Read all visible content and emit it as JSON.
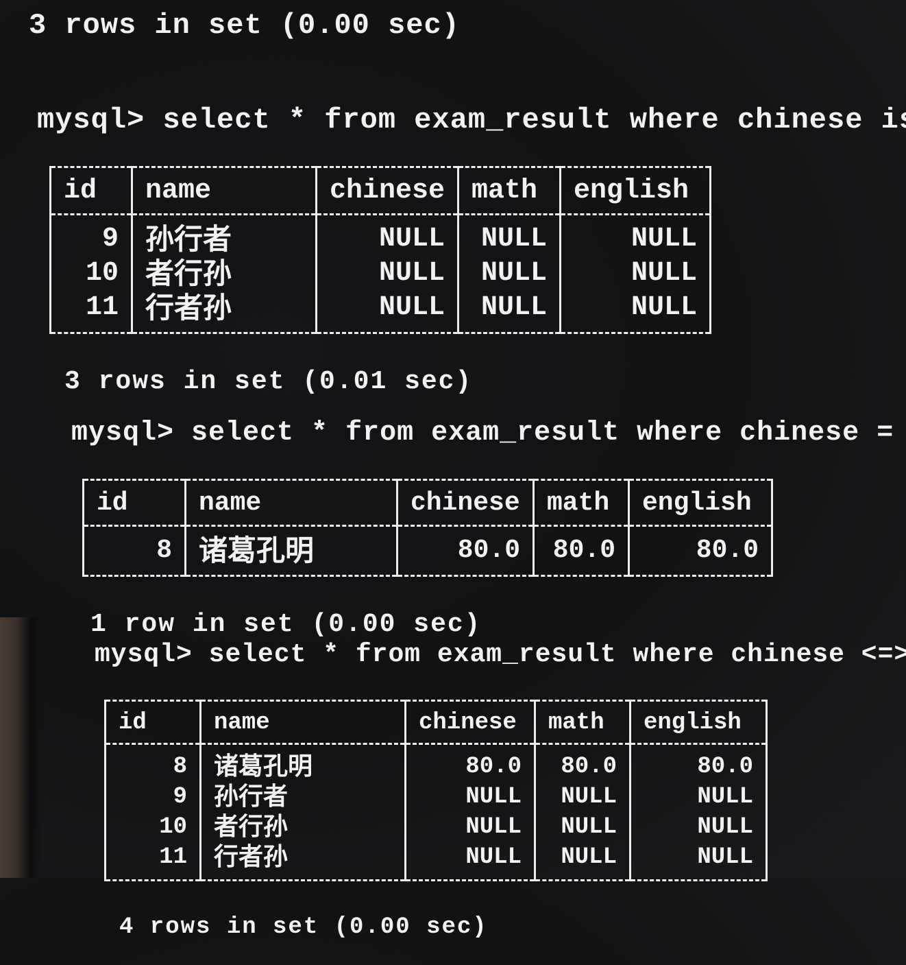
{
  "top_summary": "3 rows in set (0.00 sec)",
  "queries": [
    {
      "prompt": "mysql> ",
      "command": "select * from exam_result where chinese is null;",
      "columns": [
        "id",
        "name",
        "chinese",
        "math",
        "english"
      ],
      "rows": [
        {
          "id": "9",
          "name": "孙行者",
          "chinese": "NULL",
          "math": "NULL",
          "english": "NULL"
        },
        {
          "id": "10",
          "name": "者行孙",
          "chinese": "NULL",
          "math": "NULL",
          "english": "NULL"
        },
        {
          "id": "11",
          "name": "行者孙",
          "chinese": "NULL",
          "math": "NULL",
          "english": "NULL"
        }
      ],
      "summary": "3 rows in set (0.01 sec)"
    },
    {
      "prompt": "mysql> ",
      "command": "select * from exam_result where chinese = english;",
      "columns": [
        "id",
        "name",
        "chinese",
        "math",
        "english"
      ],
      "rows": [
        {
          "id": "8",
          "name": "诸葛孔明",
          "chinese": "80.0",
          "math": "80.0",
          "english": "80.0"
        }
      ],
      "summary": "1 row in set (0.00 sec)"
    },
    {
      "prompt": "mysql> ",
      "command": "select * from exam_result where chinese <=> english",
      "columns": [
        "id",
        "name",
        "chinese",
        "math",
        "english"
      ],
      "rows": [
        {
          "id": "8",
          "name": "诸葛孔明",
          "chinese": "80.0",
          "math": "80.0",
          "english": "80.0"
        },
        {
          "id": "9",
          "name": "孙行者",
          "chinese": "NULL",
          "math": "NULL",
          "english": "NULL"
        },
        {
          "id": "10",
          "name": "者行孙",
          "chinese": "NULL",
          "math": "NULL",
          "english": "NULL"
        },
        {
          "id": "11",
          "name": "行者孙",
          "chinese": "NULL",
          "math": "NULL",
          "english": "NULL"
        }
      ],
      "summary": "4 rows in set (0.00 sec)"
    }
  ]
}
